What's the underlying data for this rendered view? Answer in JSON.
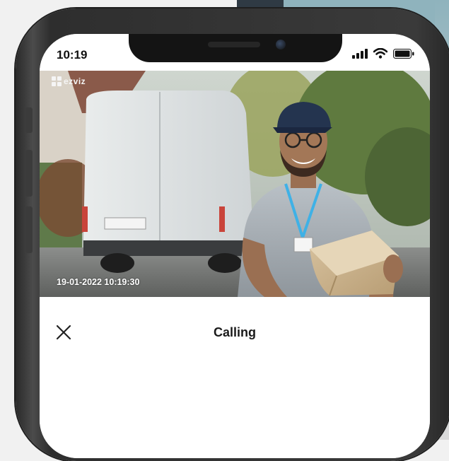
{
  "status_bar": {
    "time": "10:19",
    "icons": [
      "cellular-signal-icon",
      "wifi-icon",
      "battery-icon"
    ]
  },
  "video_feed": {
    "brand_logo": "ezviz",
    "timestamp": "19-01-2022 10:19:30"
  },
  "call_panel": {
    "title": "Calling",
    "close_icon": "close-icon"
  }
}
